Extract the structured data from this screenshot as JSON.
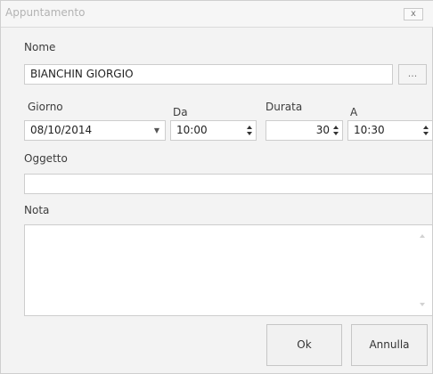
{
  "window": {
    "title": "Appuntamento",
    "close_label": "x"
  },
  "nome": {
    "label": "Nome",
    "value": "BIANCHIN GIORGIO",
    "browse_label": "..."
  },
  "giorno": {
    "label": "Giorno",
    "value": "08/10/2014"
  },
  "da": {
    "label": "Da",
    "value": "10:00"
  },
  "durata": {
    "label": "Durata",
    "value": "30"
  },
  "a": {
    "label": "A",
    "value": "10:30"
  },
  "oggetto": {
    "label": "Oggetto",
    "value": ""
  },
  "nota": {
    "label": "Nota",
    "value": ""
  },
  "buttons": {
    "ok_label": "Ok",
    "cancel_label": "Annulla"
  },
  "icons": {
    "close": "close-icon",
    "dropdown": "chevron-down-icon",
    "spinner": "spinner-arrows-icon"
  }
}
